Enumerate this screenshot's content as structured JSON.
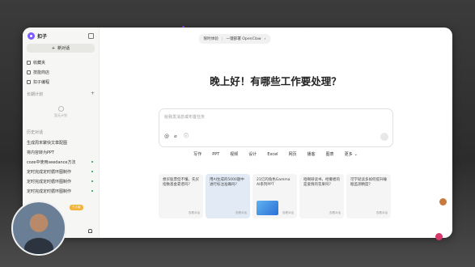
{
  "app": {
    "name": "扣子"
  },
  "sidebar": {
    "new_chat_label": "新对话",
    "nav": [
      "收藏夹",
      "技能商店",
      "扣子编程"
    ],
    "tasks_label": "长期计划",
    "tasks_empty": "暂无计划",
    "history_label": "历史对话",
    "history": [
      "生成周末聚快文章配图",
      "将内容转为PPT",
      "coze中使用seedance方法",
      "定时完成定时循环图制作",
      "定时完成定时循环图制作",
      "定时完成定时循环图制作"
    ],
    "upgrade_badge": "个人版"
  },
  "main": {
    "promo_left": "限时体验",
    "promo_right": "一键部署 OpenClaw",
    "greeting": "晚上好！有哪些工作要处理？",
    "input_placeholder": "给我发消息或布置任务",
    "tabs": [
      "写作",
      "PPT",
      "视频",
      "设计",
      "Excel",
      "网页",
      "播客",
      "图表",
      "更多"
    ],
    "cards": [
      {
        "text": "想买股票但不懂，先买指数基金靠谱吗？",
        "foot": "查看对话"
      },
      {
        "text": "用AI生成的5000题中进行标注准确吗？",
        "foot": "查看对话"
      },
      {
        "text": "21亿的角色Gamma AI系列PPT",
        "foot": "查看对话"
      },
      {
        "text": "咱啊研读书，经撤者的是爱情的花果吗？",
        "foot": "查看对话"
      },
      {
        "text": "可学就读多如何提升睡眠监测精度？",
        "foot": "查看对话"
      }
    ]
  }
}
